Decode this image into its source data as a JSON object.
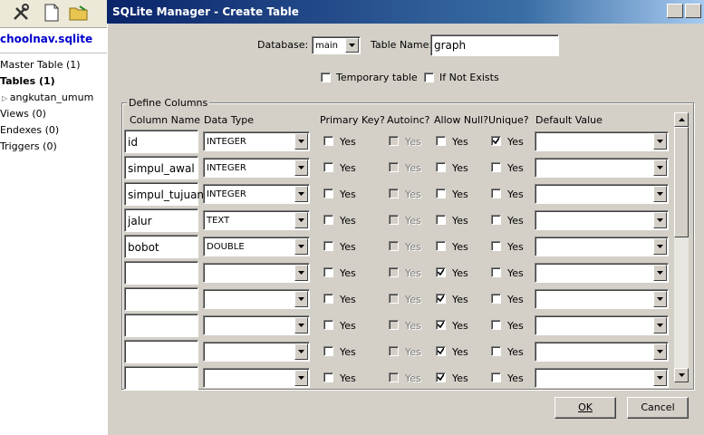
{
  "background_app": {
    "db_name": "choolnav.sqlite",
    "tree": [
      {
        "label": "Master Table (1)",
        "bold": false
      },
      {
        "label": "Tables (1)",
        "bold": true
      },
      {
        "label": "angkutan_umum",
        "bold": false,
        "child": true
      },
      {
        "label": "Views (0)",
        "bold": false
      },
      {
        "label": "Endexes (0)",
        "bold": false
      },
      {
        "label": "Triggers (0)",
        "bold": false
      }
    ]
  },
  "dialog": {
    "title": "SQLite Manager - Create Table",
    "database_label": "Database:",
    "database_value": "main",
    "table_name_label": "Table Name:",
    "table_name_value": "graph",
    "temporary_label": "Temporary table",
    "if_not_exists_label": "If Not Exists",
    "group_label": "Define Columns",
    "headers": {
      "column_name": "Column Name",
      "data_type": "Data Type",
      "primary_key": "Primary Key?",
      "autoinc": "Autoinc?",
      "allow_null": "Allow Null?",
      "unique": "Unique?",
      "default_value": "Default Value"
    },
    "yes_label": "Yes",
    "rows": [
      {
        "name": "id",
        "type": "INTEGER",
        "pk": false,
        "autoinc": false,
        "allow_null": false,
        "unique": true
      },
      {
        "name": "simpul_awal",
        "type": "INTEGER",
        "pk": false,
        "autoinc": false,
        "allow_null": false,
        "unique": false
      },
      {
        "name": "simpul_tujuan",
        "type": "INTEGER",
        "pk": false,
        "autoinc": false,
        "allow_null": false,
        "unique": false
      },
      {
        "name": "jalur",
        "type": "TEXT",
        "pk": false,
        "autoinc": false,
        "allow_null": false,
        "unique": false
      },
      {
        "name": "bobot",
        "type": "DOUBLE",
        "pk": false,
        "autoinc": false,
        "allow_null": false,
        "unique": false
      },
      {
        "name": "",
        "type": "",
        "pk": false,
        "autoinc": false,
        "allow_null": true,
        "unique": false
      },
      {
        "name": "",
        "type": "",
        "pk": false,
        "autoinc": false,
        "allow_null": true,
        "unique": false
      },
      {
        "name": "",
        "type": "",
        "pk": false,
        "autoinc": false,
        "allow_null": true,
        "unique": false
      },
      {
        "name": "",
        "type": "",
        "pk": false,
        "autoinc": false,
        "allow_null": true,
        "unique": false
      },
      {
        "name": "",
        "type": "",
        "pk": false,
        "autoinc": false,
        "allow_null": true,
        "unique": false
      }
    ],
    "ok_label": "OK",
    "cancel_label": "Cancel"
  }
}
